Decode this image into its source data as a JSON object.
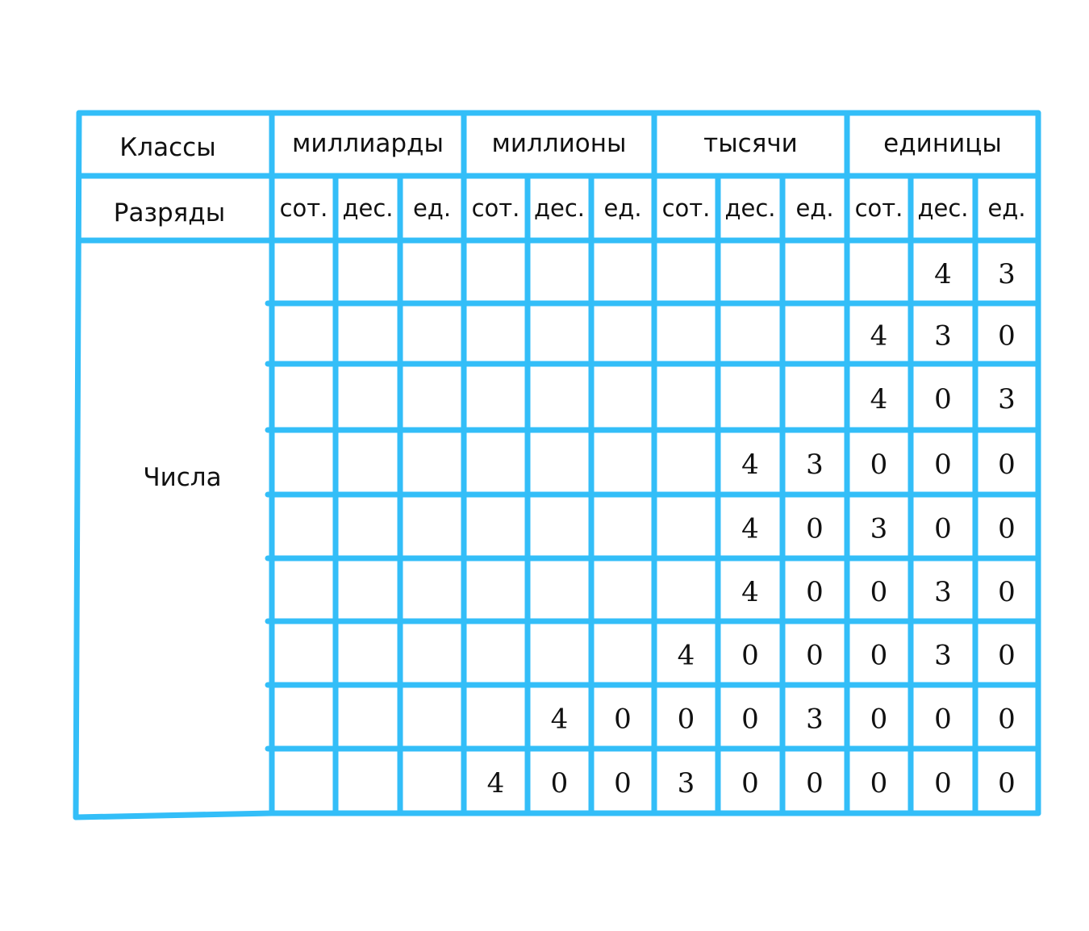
{
  "line_color": "#33bef8",
  "row_labels": {
    "classes": "Классы",
    "ranks": "Разряды",
    "numbers": "Числа"
  },
  "classes": [
    "миллиарды",
    "миллионы",
    "тысячи",
    "единицы"
  ],
  "ranks": [
    "сот.",
    "дес.",
    "ед.",
    "сот.",
    "дес.",
    "ед.",
    "сот.",
    "дес.",
    "ед.",
    "сот.",
    "дес.",
    "ед."
  ],
  "rows": [
    [
      "",
      "",
      "",
      "",
      "",
      "",
      "",
      "",
      "",
      "",
      "4",
      "3"
    ],
    [
      "",
      "",
      "",
      "",
      "",
      "",
      "",
      "",
      "",
      "4",
      "3",
      "0"
    ],
    [
      "",
      "",
      "",
      "",
      "",
      "",
      "",
      "",
      "",
      "4",
      "0",
      "3"
    ],
    [
      "",
      "",
      "",
      "",
      "",
      "",
      "",
      "4",
      "3",
      "0",
      "0",
      "0"
    ],
    [
      "",
      "",
      "",
      "",
      "",
      "",
      "",
      "4",
      "0",
      "3",
      "0",
      "0"
    ],
    [
      "",
      "",
      "",
      "",
      "",
      "",
      "",
      "4",
      "0",
      "0",
      "3",
      "0"
    ],
    [
      "",
      "",
      "",
      "",
      "",
      "",
      "4",
      "0",
      "0",
      "0",
      "3",
      "0"
    ],
    [
      "",
      "",
      "",
      "",
      "4",
      "0",
      "0",
      "0",
      "3",
      "0",
      "0",
      "0"
    ],
    [
      "",
      "",
      "",
      "4",
      "0",
      "0",
      "3",
      "0",
      "0",
      "0",
      "0",
      "0"
    ]
  ]
}
